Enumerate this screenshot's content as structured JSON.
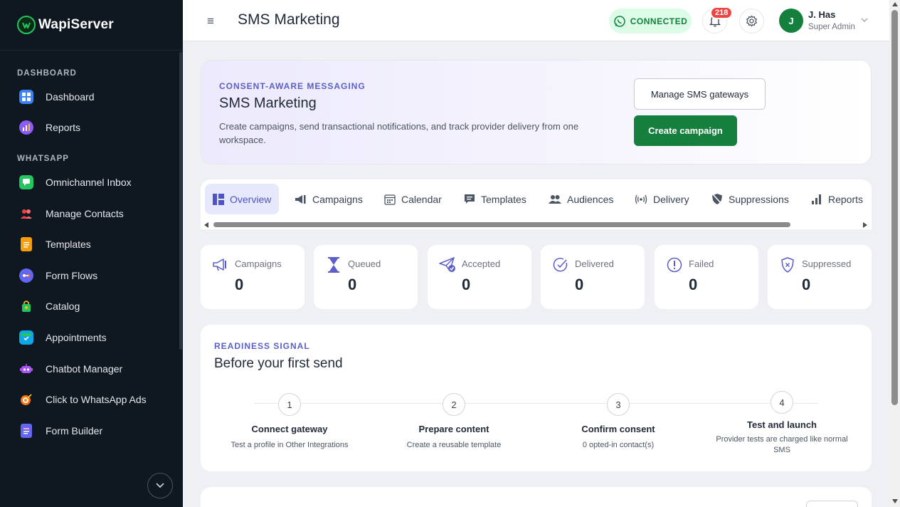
{
  "brand": {
    "name": "WapiServer"
  },
  "sidebar": {
    "sections": [
      {
        "label": "DASHBOARD"
      },
      {
        "label": "WHATSAPP"
      }
    ],
    "items": [
      {
        "label": "Dashboard",
        "icon": "dashboard-icon",
        "color": "#3b82f6"
      },
      {
        "label": "Reports",
        "icon": "reports-icon",
        "color": "#8b5cf6"
      },
      {
        "label": "Omnichannel Inbox",
        "icon": "inbox-icon",
        "color": "#22c55e"
      },
      {
        "label": "Manage Contacts",
        "icon": "contacts-icon",
        "color": "#ef4444"
      },
      {
        "label": "Templates",
        "icon": "templates-icon",
        "color": "#f59e0b"
      },
      {
        "label": "Form Flows",
        "icon": "form-flows-icon",
        "color": "#6366f1"
      },
      {
        "label": "Catalog",
        "icon": "catalog-icon",
        "color": "#22c55e"
      },
      {
        "label": "Appointments",
        "icon": "appointments-icon",
        "color": "#0ea5e9"
      },
      {
        "label": "Chatbot Manager",
        "icon": "chatbot-icon",
        "color": "#a855f7"
      },
      {
        "label": "Click to WhatsApp Ads",
        "icon": "ads-target-icon",
        "color": "#f97316"
      },
      {
        "label": "Form Builder",
        "icon": "form-builder-icon",
        "color": "#6366f1"
      }
    ]
  },
  "header": {
    "title": "SMS Marketing",
    "status": "CONNECTED",
    "notifications": "218",
    "user": {
      "initial": "J",
      "name": "J. Has",
      "role": "Super Admin"
    }
  },
  "hero": {
    "eyebrow": "CONSENT-AWARE MESSAGING",
    "title": "SMS Marketing",
    "description": "Create campaigns, send transactional notifications, and track provider delivery from one workspace.",
    "secondary_button": "Manage SMS gateways",
    "primary_button": "Create campaign"
  },
  "tabs": [
    {
      "label": "Overview",
      "icon": "overview-icon"
    },
    {
      "label": "Campaigns",
      "icon": "megaphone-icon"
    },
    {
      "label": "Calendar",
      "icon": "calendar-icon"
    },
    {
      "label": "Templates",
      "icon": "template-icon"
    },
    {
      "label": "Audiences",
      "icon": "users-icon"
    },
    {
      "label": "Delivery",
      "icon": "broadcast-icon"
    },
    {
      "label": "Suppressions",
      "icon": "shield-slash-icon"
    },
    {
      "label": "Reports",
      "icon": "bar-chart-icon"
    }
  ],
  "stats": [
    {
      "label": "Campaigns",
      "value": "0",
      "icon": "megaphone-icon"
    },
    {
      "label": "Queued",
      "value": "0",
      "icon": "hourglass-icon"
    },
    {
      "label": "Accepted",
      "value": "0",
      "icon": "paper-plane-check-icon"
    },
    {
      "label": "Delivered",
      "value": "0",
      "icon": "check-circle-icon"
    },
    {
      "label": "Failed",
      "value": "0",
      "icon": "alert-circle-icon"
    },
    {
      "label": "Suppressed",
      "value": "0",
      "icon": "shield-x-icon"
    }
  ],
  "readiness": {
    "eyebrow": "READINESS SIGNAL",
    "title": "Before your first send",
    "steps": [
      {
        "num": "1",
        "title": "Connect gateway",
        "desc": "Test a profile in Other Integrations"
      },
      {
        "num": "2",
        "title": "Prepare content",
        "desc": "Create a reusable template"
      },
      {
        "num": "3",
        "title": "Confirm consent",
        "desc": "0 opted-in contact(s)"
      },
      {
        "num": "4",
        "title": "Test and launch",
        "desc": "Provider tests are charged like normal SMS"
      }
    ]
  }
}
